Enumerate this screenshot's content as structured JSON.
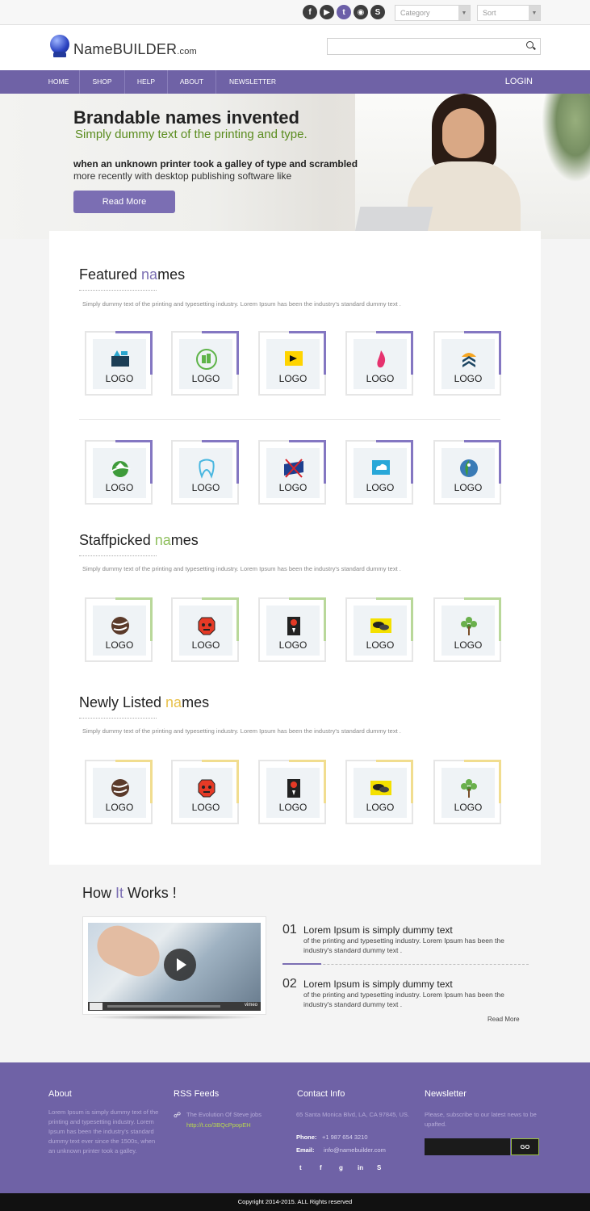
{
  "colors": {
    "brand": "#6f62a6",
    "featured_accent": "#8477c2",
    "staffpicked_accent": "#b9d89a",
    "newly_accent": "#f1dd8f",
    "green_text": "#5a8c1e"
  },
  "topbar": {
    "social_icons": [
      "facebook-icon",
      "youtube-icon",
      "twitter-icon",
      "rss-icon",
      "skype-icon"
    ],
    "social_glyphs": [
      "f",
      "▶",
      "t",
      "◉",
      "S"
    ],
    "category_select": "Category",
    "sort_select": "Sort"
  },
  "header": {
    "brand_main": "NameBUILDER",
    "brand_suffix": ".com",
    "search_placeholder": ""
  },
  "nav": {
    "items": [
      "HOME",
      "SHOP",
      "HELP",
      "ABOUT",
      "NEWSLETTER"
    ],
    "login": "LOGIN"
  },
  "hero": {
    "title": "Brandable names invented",
    "subtitle": "Simply dummy text of the printing and type.",
    "line1": "when an unknown printer took a galley of type and scrambled",
    "line2": "more recently with desktop publishing software like",
    "button": "Read More"
  },
  "featured": {
    "title_a": "Featured ",
    "title_b": "na",
    "title_c": "mes",
    "desc": "Simply dummy text of the printing and typesetting industry. Lorem Ipsum has been the industry's standard dummy text .",
    "cards": [
      "LOGO",
      "LOGO",
      "LOGO",
      "LOGO",
      "LOGO",
      "LOGO",
      "LOGO",
      "LOGO",
      "LOGO",
      "LOGO"
    ]
  },
  "staffpicked": {
    "title_a": "Staffpicked ",
    "title_b": "na",
    "title_c": "mes",
    "desc": "Simply dummy text of the printing and typesetting industry. Lorem Ipsum has been the industry's standard dummy text .",
    "cards": [
      "LOGO",
      "LOGO",
      "LOGO",
      "LOGO",
      "LOGO"
    ]
  },
  "newly": {
    "title_a": "Newly Listed ",
    "title_b": "na",
    "title_c": "mes",
    "desc": "Simply dummy text of the printing and typesetting industry. Lorem Ipsum has been the industry's standard dummy text .",
    "cards": [
      "LOGO",
      "LOGO",
      "LOGO",
      "LOGO",
      "LOGO"
    ]
  },
  "how": {
    "title_a": "How ",
    "title_b": "It",
    "title_c": " Works !",
    "video_brand": "vimeo",
    "steps": [
      {
        "num": "01",
        "title": "Lorem Ipsum is simply dummy text",
        "text": "of the printing and typesetting industry. Lorem Ipsum has been the industry's standard dummy text ."
      },
      {
        "num": "02",
        "title": "Lorem Ipsum is simply dummy text",
        "text": "of the printing and typesetting industry. Lorem Ipsum has been the industry's standard dummy text ."
      }
    ],
    "read_more": "Read More"
  },
  "footer": {
    "about_title": "About",
    "about_text": "Lorem Ipsum is simply dummy text of the printing and typesetting industry. Lorem Ipsum has been the industry's standard dummy text ever since the 1500s, when an unknown printer took a galley.",
    "rss_title": "RSS Feeds",
    "rss_item": "The Evolution Of Steve jobs",
    "rss_link": "http://t.co/3BQcPpopEH",
    "contact_title": "Contact Info",
    "address": "65 Santa Monica Blvd, LA, CA 97845, US.",
    "phone_label": "Phone:",
    "phone": "+1 987 654 3210",
    "email_label": "Email:",
    "email": "info@namebuilder.com",
    "social_glyphs": [
      "t",
      "f",
      "g",
      "in",
      "S"
    ],
    "newsletter_title": "Newsletter",
    "newsletter_text": "Please, subscribe to our latest news to be upafted.",
    "go": "GO",
    "copyright": "Copyright 2014-2015. ALL Rights reserved"
  }
}
